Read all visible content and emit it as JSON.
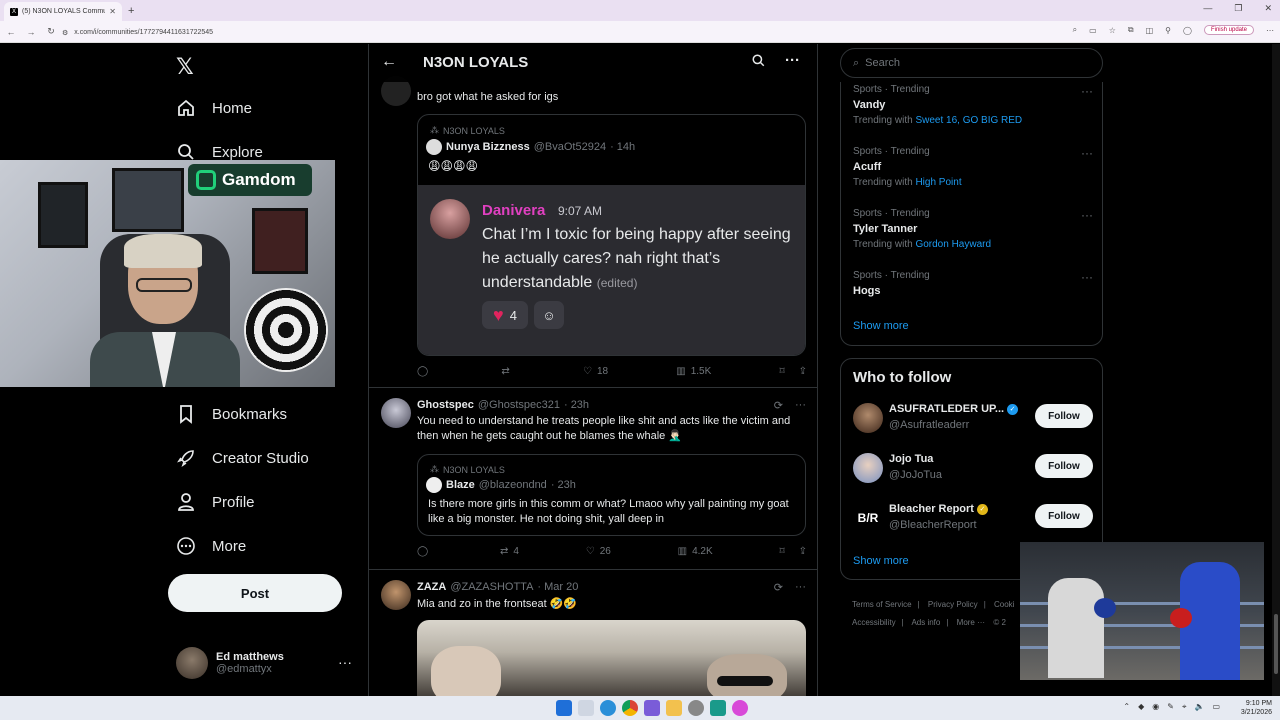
{
  "browser": {
    "tab_title": "(5) N3ON LOYALS Commun",
    "url": "x.com/i/communities/1772794411631722545",
    "finish_update": "Finish update"
  },
  "nav": {
    "home": "Home",
    "explore": "Explore",
    "bookmarks": "Bookmarks",
    "creator_studio": "Creator Studio",
    "profile": "Profile",
    "more": "More",
    "post_button": "Post",
    "account_name": "Ed matthews",
    "account_handle": "@edmattyx"
  },
  "webcam_overlay": {
    "sponsor": "Gamdom"
  },
  "header": {
    "title": "N3ON LOYALS"
  },
  "posts": [
    {
      "text": "bro got what he asked for igs",
      "quote": {
        "community": "N3ON LOYALS",
        "name": "Nunya Bizzness",
        "handle": "@BvaOt52924",
        "time": "· 14h",
        "text": "😩😩😩😩",
        "chat": {
          "name": "Danivera",
          "time": "9:07 AM",
          "message": "Chat I’m I toxic for being happy after seeing he actually cares? nah right that’s understandable",
          "edited": "(edited)",
          "reaction_count": "4"
        }
      },
      "actions": {
        "replies": "",
        "reposts": "",
        "likes": "18",
        "views": "1.5K"
      }
    },
    {
      "name": "Ghostspec",
      "handle": "@Ghostspec321",
      "time": "· 23h",
      "text": "You need to understand he treats people like shit and acts like the victim and then when he gets caught out he blames the whale 🤦🏻‍♂️",
      "quote": {
        "community": "N3ON LOYALS",
        "name": "Blaze",
        "handle": "@blazeondnd",
        "time": "· 23h",
        "text": "Is there more girls in this comm or what? Lmaoo why yall painting my goat like a big monster. He not doing shit, yall deep in"
      },
      "actions": {
        "replies": "",
        "reposts": "4",
        "likes": "26",
        "views": "4.2K"
      }
    },
    {
      "name": "ZAZA",
      "handle": "@ZAZASHOTTA",
      "time": "· Mar 20",
      "text": "Mia and zo in the frontseat 🤣🤣"
    }
  ],
  "right": {
    "search_placeholder": "Search",
    "trends": [
      {
        "category": "Sports · Trending",
        "name": "Vandy",
        "with_label": "Trending with",
        "with": "Sweet 16, GO BIG RED"
      },
      {
        "category": "Sports · Trending",
        "name": "Acuff",
        "with_label": "Trending with",
        "with": "High Point"
      },
      {
        "category": "Sports · Trending",
        "name": "Tyler Tanner",
        "with_label": "Trending with",
        "with": "Gordon Hayward"
      },
      {
        "category": "Sports · Trending",
        "name": "Hogs",
        "with_label": "",
        "with": ""
      }
    ],
    "show_more": "Show more",
    "who_to_follow": "Who to follow",
    "follow_suggestions": [
      {
        "name": "ASUFRATLEDER UP...",
        "handle": "@Asufratleaderr",
        "button": "Follow",
        "badge_color": "#1d9bf0"
      },
      {
        "name": "Jojo Tua",
        "handle": "@JoJoTua",
        "button": "Follow",
        "badge_color": ""
      },
      {
        "name": "Bleacher Report",
        "handle": "@BleacherReport",
        "button": "Follow",
        "badge_color": "#e2b719"
      }
    ],
    "show_more_2": "Show more",
    "footer": [
      "Terms of Service",
      "Privacy Policy",
      "Cooki",
      "Accessibility",
      "Ads info",
      "More ···",
      "© 2"
    ]
  },
  "taskbar": {
    "time": "9:10 PM",
    "date": "3/21/2026"
  },
  "colors": {
    "accent": "#1d9bf0",
    "background": "#000000",
    "chat_name": "#e040c0",
    "heart": "#e0245e"
  }
}
